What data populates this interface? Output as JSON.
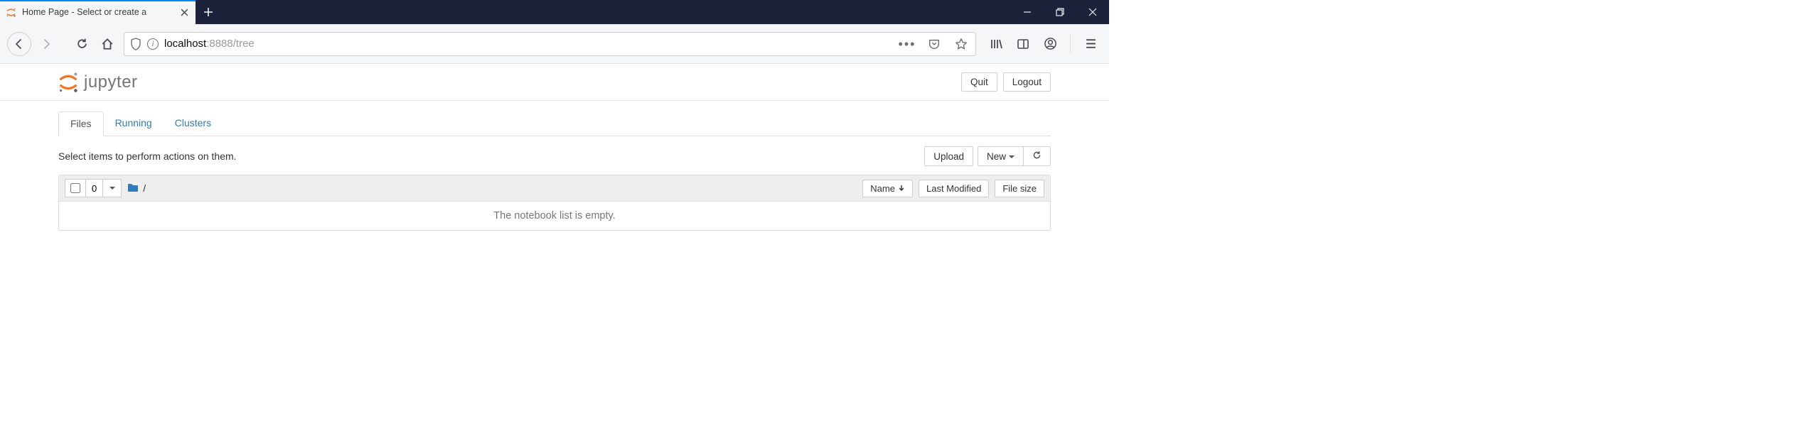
{
  "browser": {
    "tab_title": "Home Page - Select or create a",
    "url_host": "localhost",
    "url_port": ":8888",
    "url_path": "/tree"
  },
  "header": {
    "brand": "jupyter",
    "quit_label": "Quit",
    "logout_label": "Logout"
  },
  "tabs": {
    "files": "Files",
    "running": "Running",
    "clusters": "Clusters"
  },
  "actions": {
    "hint": "Select items to perform actions on them.",
    "upload": "Upload",
    "new": "New",
    "selected_count": "0",
    "breadcrumb_root": "/"
  },
  "columns": {
    "name": "Name",
    "last_modified": "Last Modified",
    "file_size": "File size"
  },
  "list": {
    "empty": "The notebook list is empty."
  }
}
